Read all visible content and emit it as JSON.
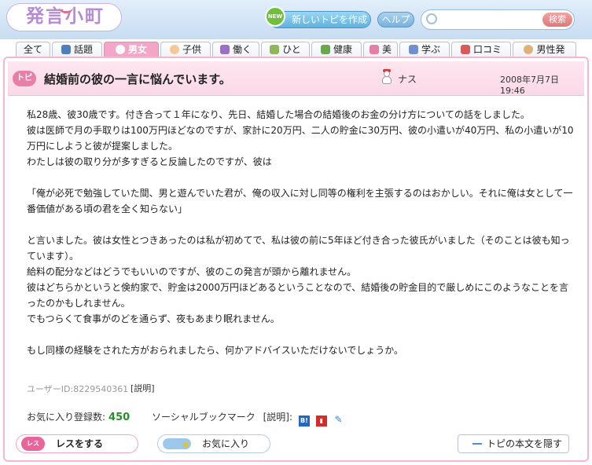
{
  "header": {
    "logo": "発言小町",
    "new_badge": "NEW",
    "new_topic_label": "新しいトピを作成",
    "help_label": "ヘルプ",
    "search_placeholder": "",
    "search_label": "検索"
  },
  "tabs": [
    {
      "label": "全て",
      "icon": "none"
    },
    {
      "label": "話題",
      "icon": "newspaper-icon"
    },
    {
      "label": "男女",
      "icon": "heart-icon",
      "active": true
    },
    {
      "label": "子供",
      "icon": "baby-icon"
    },
    {
      "label": "働く",
      "icon": "bag-icon"
    },
    {
      "label": "ひと",
      "icon": "people-icon"
    },
    {
      "label": "健康",
      "icon": "cross-icon"
    },
    {
      "label": "美",
      "icon": "lipstick-icon"
    },
    {
      "label": "学ぶ",
      "icon": "book-icon"
    },
    {
      "label": "口コミ",
      "icon": "bus-icon"
    },
    {
      "label": "男性発",
      "icon": "man-icon"
    }
  ],
  "topic": {
    "badge": "トピ",
    "title": "結婚前の彼の一言に悩んでいます。",
    "author": "ナス",
    "date": "2008年7月7日 19:46",
    "body": [
      "私28歳、彼30歳です。付き合って１年になり、先日、結婚した場合の結婚後のお金の分け方についての話をしました。",
      "彼は医師で月の手取りは100万円ほどなのですが、家計に20万円、二人の貯金に30万円、彼の小遣いが40万円、私の小遣いが10万円にしようと彼が提案しました。",
      "わたしは彼の取り分が多すぎると反論したのですが、彼は",
      "",
      "「俺が必死で勉強していた間、男と遊んでいた君が、俺の収入に対し同等の権利を主張するのはおかしい。それに俺は女として一番価値がある頃の君を全く知らない」",
      "",
      "と言いました。彼は女性とつきあったのは私が初めてで、私は彼の前に5年ほど付き合った彼氏がいました（そのことは彼も知っています）。",
      "給料の配分などはどうでもいいのですが、彼のこの発言が頭から離れません。",
      "彼はどちらかというと倹約家で、貯金は2000万円ほどあるということなので、結婚後の貯金目的で厳しめにこのようなことを言ったのかもしれません。",
      "でもつらくて食事がのどを通らず、夜もあまり眠れません。",
      "",
      "もし同様の経験をされた方がおられましたら、何かアドバイスいただけないでしょうか。"
    ],
    "user_id": "ユーザーID:8229540361",
    "user_id_help": "[説明]",
    "favorite_label": "お気に入り登録数:",
    "favorite_count": "450",
    "social_label": "ソーシャルブックマーク",
    "social_help": "[説明]:",
    "social_icons": [
      "hatena-bookmark-icon",
      "clip-icon",
      "delicious-icon"
    ]
  },
  "actions": {
    "res_badge": "レス",
    "res_label": "レスをする",
    "fav_label": "お気に入り",
    "hide_label": "トピの本文を隠す"
  }
}
